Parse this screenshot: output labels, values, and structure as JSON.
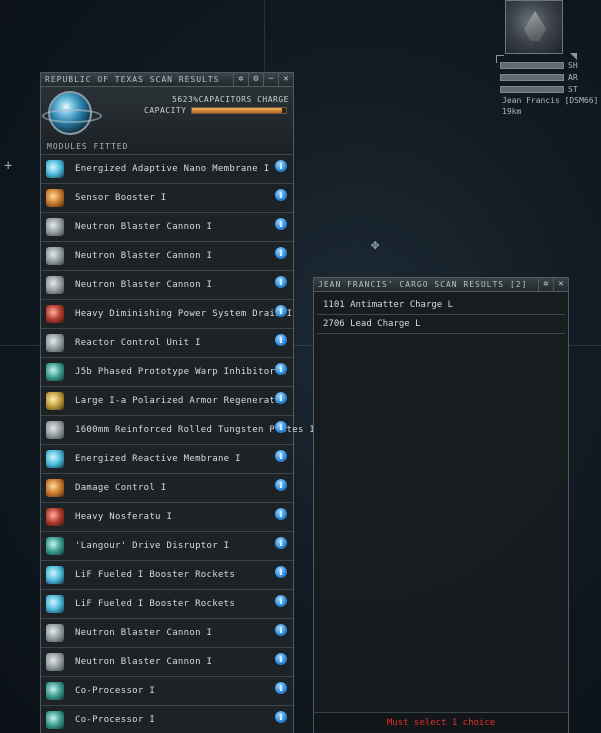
{
  "target": {
    "bars": [
      "SH",
      "AR",
      "ST"
    ],
    "name": "Jean Francis [DSM66]",
    "distance": "19km"
  },
  "scan_window": {
    "title": "REPUBLIC OF TEXAS SCAN RESULTS",
    "capacitor_charge": "5623%CAPACITORS CHARGE",
    "capacity_label": "CAPACITY",
    "section_label": "MODULES FITTED",
    "modules": [
      {
        "name": "Energized Adaptive Nano Membrane I",
        "icon": "armor-membrane-icon"
      },
      {
        "name": "Sensor Booster I",
        "icon": "sensor-booster-icon"
      },
      {
        "name": "Neutron Blaster Cannon I",
        "icon": "blaster-icon"
      },
      {
        "name": "Neutron Blaster Cannon I",
        "icon": "blaster-icon"
      },
      {
        "name": "Neutron Blaster Cannon I",
        "icon": "blaster-icon"
      },
      {
        "name": "Heavy Diminishing Power System Drain I",
        "icon": "energy-drain-icon"
      },
      {
        "name": "Reactor Control Unit I",
        "icon": "reactor-icon"
      },
      {
        "name": "J5b Phased Prototype Warp Inhibitor I",
        "icon": "warp-scrambler-icon"
      },
      {
        "name": "Large I-a Polarized Armor Regenerator",
        "icon": "armor-repairer-icon"
      },
      {
        "name": "1600mm Reinforced Rolled Tungsten Plates I",
        "icon": "armor-plate-icon"
      },
      {
        "name": "Energized Reactive Membrane I",
        "icon": "armor-membrane-icon"
      },
      {
        "name": "Damage Control I",
        "icon": "damage-control-icon"
      },
      {
        "name": "Heavy Nosferatu I",
        "icon": "nosferatu-icon"
      },
      {
        "name": "'Langour' Drive Disruptor I",
        "icon": "drive-disruptor-icon"
      },
      {
        "name": "LiF Fueled I Booster Rockets",
        "icon": "booster-rockets-icon"
      },
      {
        "name": "LiF Fueled I Booster Rockets",
        "icon": "booster-rockets-icon"
      },
      {
        "name": "Neutron Blaster Cannon I",
        "icon": "blaster-icon"
      },
      {
        "name": "Neutron Blaster Cannon I",
        "icon": "blaster-icon"
      },
      {
        "name": "Co-Processor I",
        "icon": "co-processor-icon"
      },
      {
        "name": "Co-Processor I",
        "icon": "co-processor-icon"
      }
    ]
  },
  "cargo_window": {
    "title": "JEAN FRANCIS' CARGO SCAN RESULTS [2]",
    "items": [
      "1101 Antimatter Charge L",
      "2706 Lead Charge L"
    ],
    "status": "Must select 1 choice"
  }
}
